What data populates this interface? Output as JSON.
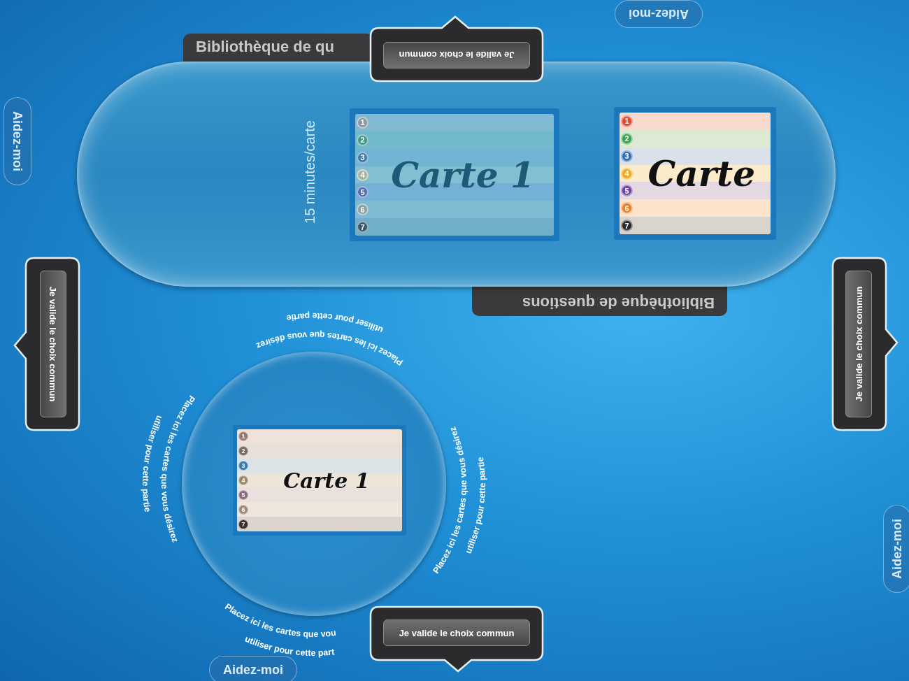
{
  "help_buttons": [
    {
      "label": "Aidez-moi"
    },
    {
      "label": "Aidez-moi"
    },
    {
      "label": "Aidez-moi"
    },
    {
      "label": "Aidez-moi"
    }
  ],
  "library": {
    "tabs": [
      {
        "label": "Bibliothèque de qu"
      },
      {
        "label": "Bibliothèque de questions"
      }
    ],
    "duration": "15 minutes/carte",
    "cards": [
      {
        "title": "Carte 1",
        "faded": true,
        "chips": [
          {
            "label": "1",
            "color": "#8a9aa4"
          },
          {
            "label": "2",
            "color": "#3f9a8a"
          },
          {
            "label": "3",
            "color": "#3f7fb0"
          },
          {
            "label": "4",
            "color": "#a8b4a0"
          },
          {
            "label": "5",
            "color": "#4f6fb0"
          },
          {
            "label": "6",
            "color": "#8aa0a8"
          },
          {
            "label": "7",
            "color": "#3a5a70"
          }
        ]
      },
      {
        "title": "Carte",
        "faded": false,
        "chips": [
          {
            "label": "1",
            "color": "#e0462a"
          },
          {
            "label": "2",
            "color": "#3aa24a"
          },
          {
            "label": "3",
            "color": "#2f6fb8"
          },
          {
            "label": "4",
            "color": "#f0a51c"
          },
          {
            "label": "5",
            "color": "#6b3fa0"
          },
          {
            "label": "6",
            "color": "#f07c20"
          },
          {
            "label": "7",
            "color": "#2a2a2a"
          }
        ]
      }
    ]
  },
  "selection_zone": {
    "hints": [
      {
        "lines": [
          "Placez ici les cartes que vous désirez",
          "utiliser pour cette partie"
        ]
      },
      {
        "lines": [
          "Placez ici les cartes que vous désirez",
          "utiliser pour cette partie"
        ]
      },
      {
        "lines": [
          "Placez ici les cartes que vous désirez",
          "utiliser pour cette partie"
        ]
      },
      {
        "lines": [
          "Placez ici les cartes que vou",
          "utiliser pour cette part"
        ]
      }
    ],
    "cards": [
      {
        "title": "Carte 1",
        "faded": false,
        "chips": [
          {
            "label": "1",
            "color": "#9a7a6c"
          },
          {
            "label": "2",
            "color": "#7a6a60"
          },
          {
            "label": "3",
            "color": "#3a7ab0"
          },
          {
            "label": "4",
            "color": "#a08868"
          },
          {
            "label": "5",
            "color": "#8a6a80"
          },
          {
            "label": "6",
            "color": "#a08a78"
          },
          {
            "label": "7",
            "color": "#3a2e2e"
          }
        ]
      }
    ]
  },
  "validate_popups": [
    {
      "label": "Je valide le choix commun"
    },
    {
      "label": "Je valide le choix commun"
    },
    {
      "label": "Je valide le choix commun"
    },
    {
      "label": "Je valide le choix commun"
    }
  ]
}
